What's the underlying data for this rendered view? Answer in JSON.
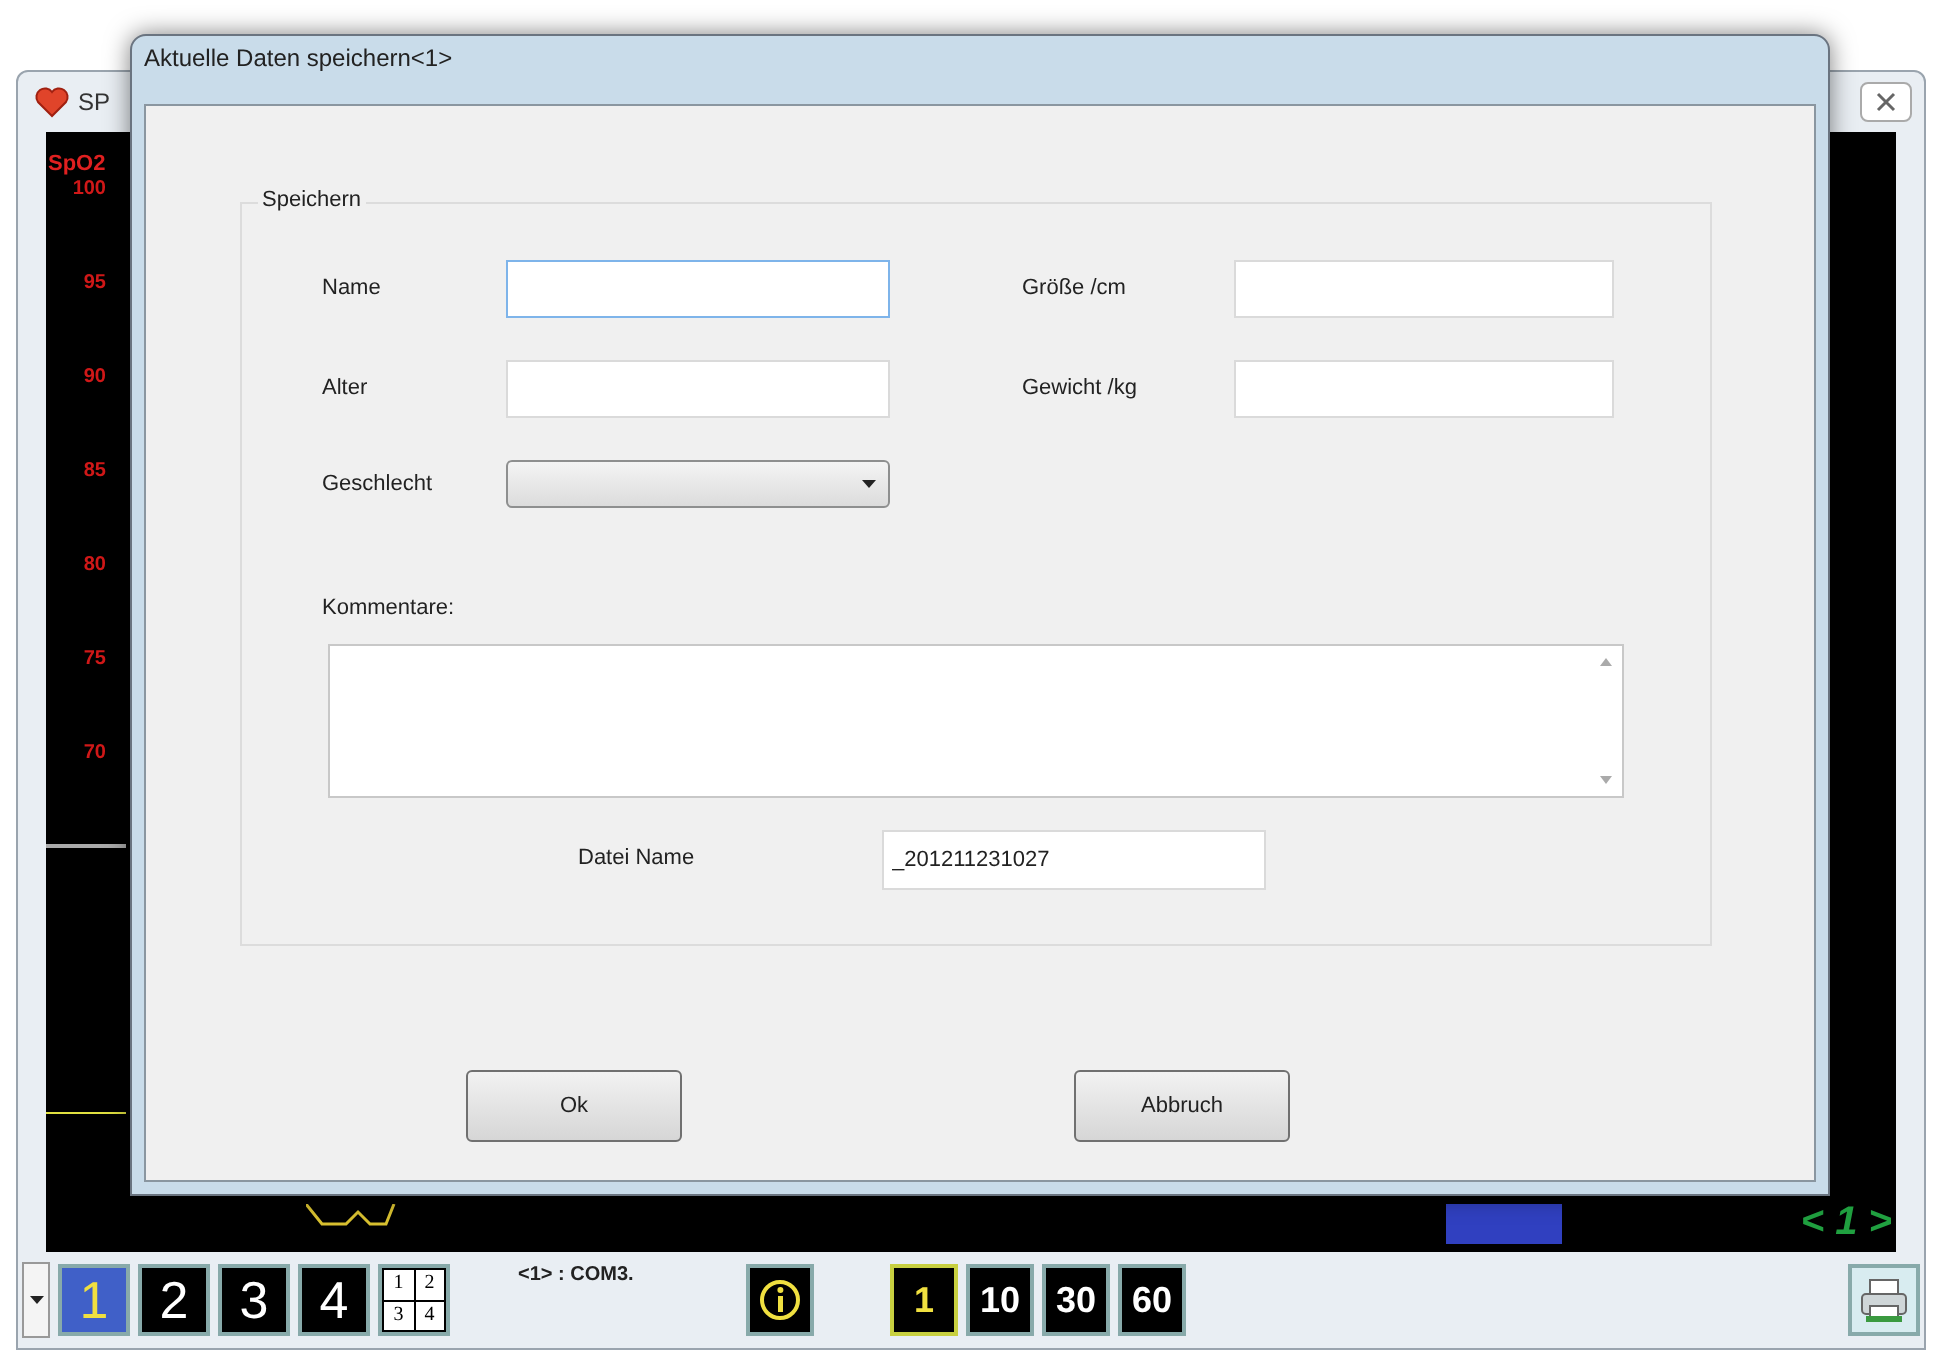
{
  "app_window": {
    "title": "SP",
    "chart_label": "SpO2",
    "y_ticks": [
      "100",
      "95",
      "90",
      "85",
      "80",
      "75",
      "70"
    ],
    "page_indicator": "< 1 >"
  },
  "toolbar": {
    "view_buttons": [
      {
        "label": "1",
        "selected": true
      },
      {
        "label": "2",
        "selected": false
      },
      {
        "label": "3",
        "selected": false
      },
      {
        "label": "4",
        "selected": false
      }
    ],
    "grid_labels": [
      "1",
      "2",
      "3",
      "4"
    ],
    "port_label": "<1> : COM3.",
    "time_buttons": [
      {
        "label": "1",
        "selected": true
      },
      {
        "label": "10",
        "selected": false
      },
      {
        "label": "30",
        "selected": false
      },
      {
        "label": "60",
        "selected": false
      }
    ]
  },
  "dialog": {
    "title": "Aktuelle Daten speichern<1>",
    "group_title": "Speichern",
    "fields": [
      {
        "label": "Name",
        "kind": "text",
        "focused": true
      },
      {
        "label": "Größe /cm",
        "kind": "text",
        "focused": false
      },
      {
        "label": "Alter",
        "kind": "text",
        "focused": false
      },
      {
        "label": "Gewicht /kg",
        "kind": "text",
        "focused": false
      },
      {
        "label": "Geschlecht",
        "kind": "select",
        "focused": false
      }
    ],
    "comments_label": "Kommentare:",
    "filename_label": "Datei Name",
    "filename_value": "_201211231027",
    "buttons": [
      "Ok",
      "Abbruch"
    ]
  }
}
